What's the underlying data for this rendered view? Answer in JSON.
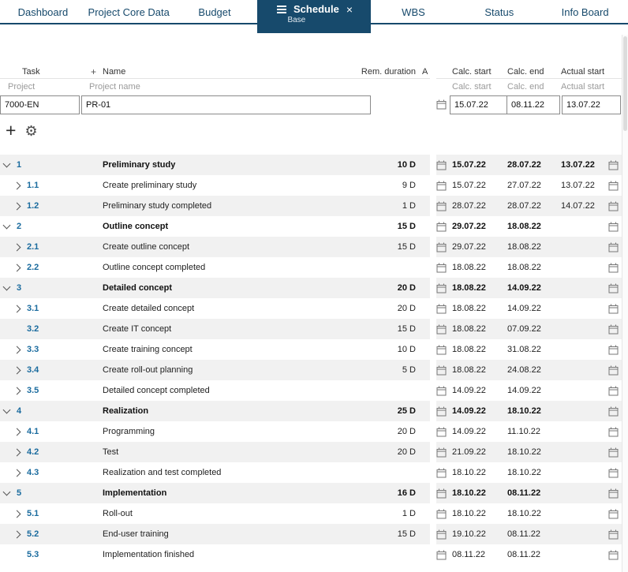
{
  "colors": {
    "navy": "#174a6c",
    "link": "#1a6b9e",
    "stripe": "#f1f1f1"
  },
  "tabs": [
    {
      "label": "Dashboard"
    },
    {
      "label": "Project Core Data"
    },
    {
      "label": "Budget"
    },
    {
      "label": "Schedule",
      "sub": "Base",
      "active": true
    },
    {
      "label": "WBS"
    },
    {
      "label": "Status"
    },
    {
      "label": "Info Board"
    }
  ],
  "grid": {
    "headers": {
      "task": "Task",
      "plus": "+",
      "name": "Name",
      "rem_duration": "Rem. duration",
      "a": "A",
      "calc_start": "Calc. start",
      "calc_end": "Calc. end",
      "actual_start": "Actual start"
    },
    "filters": {
      "task": "Project",
      "name": "Project name",
      "calc_start": "Calc. start",
      "calc_end": "Calc. end",
      "actual_start": "Actual start"
    },
    "project_row": {
      "task": "7000-EN",
      "name": "PR-01",
      "calc_start": "15.07.22",
      "calc_end": "08.11.22",
      "actual_start": "13.07.22"
    }
  },
  "toolbar": {
    "add": "+",
    "settings": "⚙"
  },
  "rows": [
    {
      "id": "1",
      "name": "Preliminary study",
      "rem": "10 D",
      "calc_start": "15.07.22",
      "calc_end": "28.07.22",
      "actual_start": "13.07.22",
      "level": 0,
      "chevron": "down",
      "bold": true
    },
    {
      "id": "1.1",
      "name": "Create preliminary study",
      "rem": "9 D",
      "calc_start": "15.07.22",
      "calc_end": "27.07.22",
      "actual_start": "13.07.22",
      "level": 1,
      "chevron": "right",
      "bold": false
    },
    {
      "id": "1.2",
      "name": "Preliminary study completed",
      "rem": "1 D",
      "calc_start": "28.07.22",
      "calc_end": "28.07.22",
      "actual_start": "14.07.22",
      "level": 1,
      "chevron": "right",
      "bold": false
    },
    {
      "id": "2",
      "name": "Outline concept",
      "rem": "15 D",
      "calc_start": "29.07.22",
      "calc_end": "18.08.22",
      "actual_start": "",
      "level": 0,
      "chevron": "down",
      "bold": true
    },
    {
      "id": "2.1",
      "name": "Create outline concept",
      "rem": "15 D",
      "calc_start": "29.07.22",
      "calc_end": "18.08.22",
      "actual_start": "",
      "level": 1,
      "chevron": "right",
      "bold": false
    },
    {
      "id": "2.2",
      "name": "Outline concept completed",
      "rem": "",
      "calc_start": "18.08.22",
      "calc_end": "18.08.22",
      "actual_start": "",
      "level": 1,
      "chevron": "right",
      "bold": false
    },
    {
      "id": "3",
      "name": "Detailed concept",
      "rem": "20 D",
      "calc_start": "18.08.22",
      "calc_end": "14.09.22",
      "actual_start": "",
      "level": 0,
      "chevron": "down",
      "bold": true
    },
    {
      "id": "3.1",
      "name": "Create detailed concept",
      "rem": "20 D",
      "calc_start": "18.08.22",
      "calc_end": "14.09.22",
      "actual_start": "",
      "level": 1,
      "chevron": "right",
      "bold": false
    },
    {
      "id": "3.2",
      "name": "Create IT concept",
      "rem": "15 D",
      "calc_start": "18.08.22",
      "calc_end": "07.09.22",
      "actual_start": "",
      "level": 1,
      "chevron": "none",
      "bold": false
    },
    {
      "id": "3.3",
      "name": "Create training concept",
      "rem": "10 D",
      "calc_start": "18.08.22",
      "calc_end": "31.08.22",
      "actual_start": "",
      "level": 1,
      "chevron": "right",
      "bold": false
    },
    {
      "id": "3.4",
      "name": "Create roll-out planning",
      "rem": "5 D",
      "calc_start": "18.08.22",
      "calc_end": "24.08.22",
      "actual_start": "",
      "level": 1,
      "chevron": "right",
      "bold": false
    },
    {
      "id": "3.5",
      "name": "Detailed concept completed",
      "rem": "",
      "calc_start": "14.09.22",
      "calc_end": "14.09.22",
      "actual_start": "",
      "level": 1,
      "chevron": "right",
      "bold": false
    },
    {
      "id": "4",
      "name": "Realization",
      "rem": "25 D",
      "calc_start": "14.09.22",
      "calc_end": "18.10.22",
      "actual_start": "",
      "level": 0,
      "chevron": "down",
      "bold": true
    },
    {
      "id": "4.1",
      "name": "Programming",
      "rem": "20 D",
      "calc_start": "14.09.22",
      "calc_end": "11.10.22",
      "actual_start": "",
      "level": 1,
      "chevron": "right",
      "bold": false
    },
    {
      "id": "4.2",
      "name": "Test",
      "rem": "20 D",
      "calc_start": "21.09.22",
      "calc_end": "18.10.22",
      "actual_start": "",
      "level": 1,
      "chevron": "right",
      "bold": false
    },
    {
      "id": "4.3",
      "name": "Realization and test completed",
      "rem": "",
      "calc_start": "18.10.22",
      "calc_end": "18.10.22",
      "actual_start": "",
      "level": 1,
      "chevron": "right",
      "bold": false
    },
    {
      "id": "5",
      "name": "Implementation",
      "rem": "16 D",
      "calc_start": "18.10.22",
      "calc_end": "08.11.22",
      "actual_start": "",
      "level": 0,
      "chevron": "down",
      "bold": true
    },
    {
      "id": "5.1",
      "name": "Roll-out",
      "rem": "1 D",
      "calc_start": "18.10.22",
      "calc_end": "18.10.22",
      "actual_start": "",
      "level": 1,
      "chevron": "right",
      "bold": false
    },
    {
      "id": "5.2",
      "name": "End-user training",
      "rem": "15 D",
      "calc_start": "19.10.22",
      "calc_end": "08.11.22",
      "actual_start": "",
      "level": 1,
      "chevron": "right",
      "bold": false
    },
    {
      "id": "5.3",
      "name": "Implementation finished",
      "rem": "",
      "calc_start": "08.11.22",
      "calc_end": "08.11.22",
      "actual_start": "",
      "level": 1,
      "chevron": "none",
      "bold": false
    }
  ]
}
